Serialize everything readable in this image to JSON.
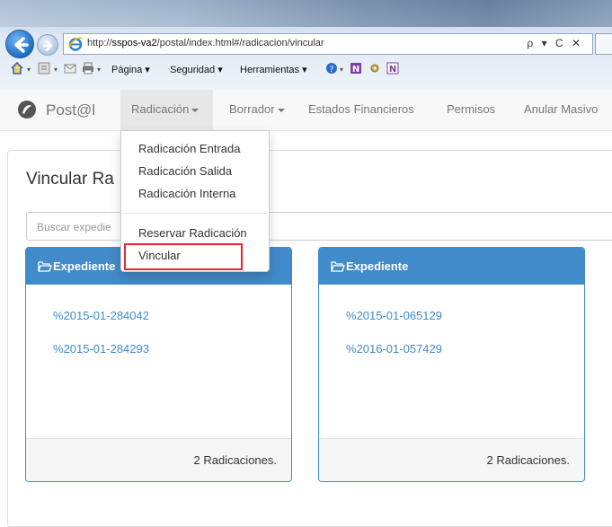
{
  "browser": {
    "url_prefix": "http://",
    "url_host": "sspos-va2",
    "url_path": "/postal/index.html#/radicacion/vincular",
    "addr_controls": "ρ ▾ C ✕",
    "commands": {
      "pagina": "Página ▾",
      "seguridad": "Seguridad ▾",
      "herramientas": "Herramientas ▾"
    }
  },
  "navbar": {
    "brand": "Post@l",
    "items": {
      "radicacion": "Radicación",
      "borrador": "Borrador",
      "estados": "Estados Financieros",
      "permisos": "Permisos",
      "anular": "Anular Masivo"
    }
  },
  "dropdown": {
    "entrada": "Radicación Entrada",
    "salida": "Radicación Salida",
    "interna": "Radicación Interna",
    "reservar": "Reservar Radicación",
    "vincular": "Vincular"
  },
  "page": {
    "title": "Vincular Ra",
    "search_placeholder": "Buscar expedie"
  },
  "cards": [
    {
      "header": "Expediente",
      "links": [
        "2015-01-284042",
        "2015-01-284293"
      ],
      "footer": "2 Radicaciones."
    },
    {
      "header": "Expediente",
      "links": [
        "2015-01-065129",
        "2016-01-057429"
      ],
      "footer": "2 Radicaciones."
    }
  ],
  "colors": {
    "primary": "#428bca",
    "highlight": "#e3282e"
  }
}
